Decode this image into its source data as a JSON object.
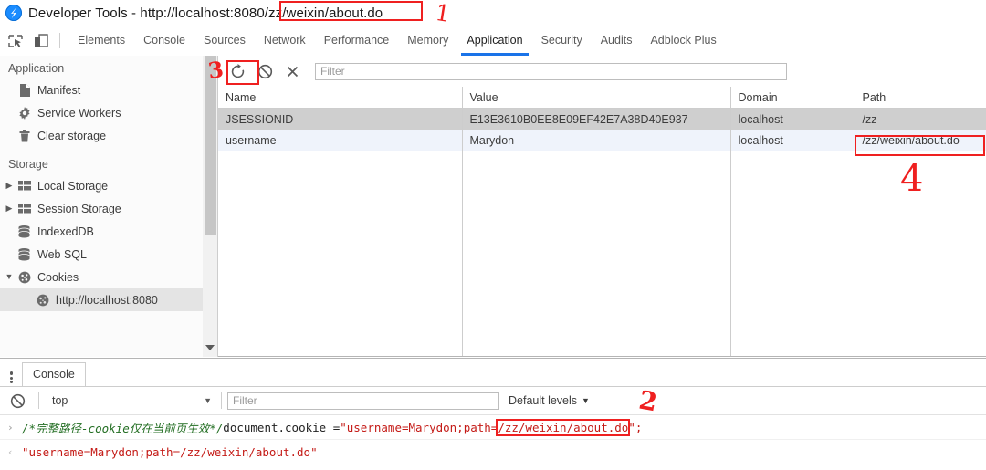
{
  "window": {
    "title": "Developer Tools - http://localhost:8080/zz/weixin/about.do",
    "title_prefix": "Developer Tools - http://localhost:8080",
    "title_highlight": "/zz/weixin/about.do",
    "icon": "chrome-devtools-icon"
  },
  "toolbar": {
    "inspect_icon": "inspect-element-icon",
    "device_icon": "device-toolbar-icon",
    "tabs": [
      {
        "label": "Elements",
        "active": false
      },
      {
        "label": "Console",
        "active": false
      },
      {
        "label": "Sources",
        "active": false
      },
      {
        "label": "Network",
        "active": false
      },
      {
        "label": "Performance",
        "active": false
      },
      {
        "label": "Memory",
        "active": false
      },
      {
        "label": "Application",
        "active": true
      },
      {
        "label": "Security",
        "active": false
      },
      {
        "label": "Audits",
        "active": false
      },
      {
        "label": "Adblock Plus",
        "active": false
      }
    ]
  },
  "sidebar": {
    "sections": [
      {
        "title": "Application",
        "items": [
          {
            "label": "Manifest",
            "icon": "document-icon",
            "twisty": "",
            "selected": false,
            "indent": false
          },
          {
            "label": "Service Workers",
            "icon": "gear-icon",
            "twisty": "",
            "selected": false,
            "indent": false
          },
          {
            "label": "Clear storage",
            "icon": "trash-icon",
            "twisty": "",
            "selected": false,
            "indent": false
          }
        ]
      },
      {
        "title": "Storage",
        "items": [
          {
            "label": "Local Storage",
            "icon": "table-icon",
            "twisty": "▶",
            "selected": false,
            "indent": false
          },
          {
            "label": "Session Storage",
            "icon": "table-icon",
            "twisty": "▶",
            "selected": false,
            "indent": false
          },
          {
            "label": "IndexedDB",
            "icon": "database-icon",
            "twisty": "",
            "selected": false,
            "indent": false
          },
          {
            "label": "Web SQL",
            "icon": "database-icon",
            "twisty": "",
            "selected": false,
            "indent": false
          },
          {
            "label": "Cookies",
            "icon": "cookie-icon",
            "twisty": "▼",
            "selected": false,
            "indent": false
          },
          {
            "label": "http://localhost:8080",
            "icon": "cookie-icon",
            "twisty": "",
            "selected": true,
            "indent": true
          }
        ]
      }
    ]
  },
  "cookie_panel": {
    "refresh_icon": "refresh-icon",
    "clear_icon": "clear-all-cookies-icon",
    "delete_icon": "delete-selected-cookie-icon",
    "filter_placeholder": "Filter",
    "filter_value": "",
    "columns": [
      "Name",
      "Value",
      "Domain",
      "Path"
    ],
    "rows": [
      {
        "name": "JSESSIONID",
        "value": "E13E3610B0EE8E09EF42E7A38D40E937",
        "domain": "localhost",
        "path": "/zz",
        "state": "selected"
      },
      {
        "name": "username",
        "value": "Marydon",
        "domain": "localhost",
        "path": "/zz/weixin/about.do",
        "state": "focused"
      }
    ]
  },
  "drawer": {
    "menu_icon": "more-options-icon",
    "tabs": [
      {
        "label": "Console",
        "active": true
      }
    ],
    "clear_icon": "clear-console-icon",
    "context_value": "top",
    "context_caret": "▼",
    "filter_placeholder": "Filter",
    "filter_value": "",
    "levels_label": "Default levels",
    "levels_caret": "▼",
    "lines": [
      {
        "marker": "›",
        "type": "input",
        "comment": "/*完整路径-cookie仅在当前页生效*/",
        "code": "document.cookie = ",
        "string_pre": "\"username=Marydon;path=",
        "string_hl": "/zz/weixin/about.do",
        "string_post": "\";"
      },
      {
        "marker": "‹",
        "type": "output",
        "text": "\"username=Marydon;path=/zz/weixin/about.do\""
      }
    ]
  },
  "annotations": {
    "marks": [
      {
        "label": "1",
        "kind": "handwritten-number"
      },
      {
        "label": "3",
        "kind": "handwritten-number"
      },
      {
        "label": "4",
        "kind": "handwritten-number"
      },
      {
        "label": "2",
        "kind": "handwritten-number"
      }
    ],
    "color": "#ef2020",
    "boxes": [
      "title-path-box",
      "refresh-button-box",
      "cookie-path-cell-box",
      "console-path-string-box"
    ]
  }
}
